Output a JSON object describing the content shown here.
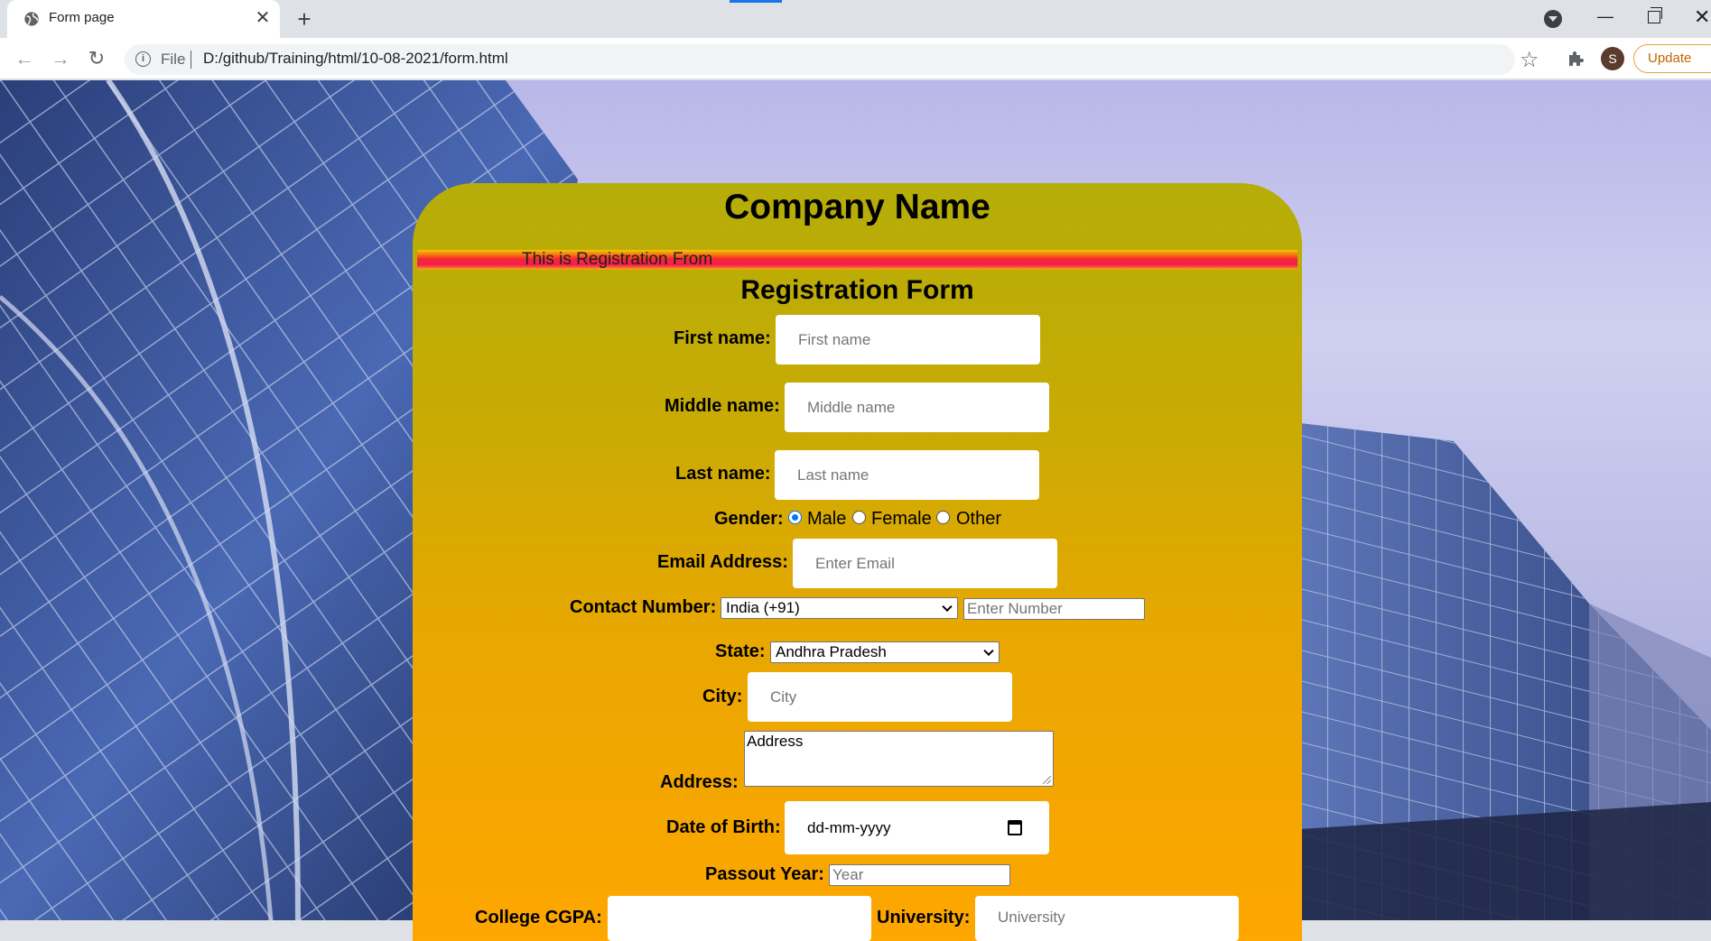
{
  "browser": {
    "tab_title": "Form page",
    "new_tab_symbol": "+",
    "close_symbol": "✕",
    "scheme": "File",
    "url": "D:/github/Training/html/10-08-2021/form.html",
    "profile_initial": "S",
    "update_label": "Update",
    "accent": "#1a73e8"
  },
  "page": {
    "company_name": "Company Name",
    "marquee": "This is Registration From",
    "form_title": "Registration Form",
    "panel_colors": [
      "#b5ad08",
      "#ffa600"
    ]
  },
  "form": {
    "first_name": {
      "label": "First name:",
      "placeholder": "First name"
    },
    "middle_name": {
      "label": "Middle name:",
      "placeholder": "Middle name"
    },
    "last_name": {
      "label": "Last name:",
      "placeholder": "Last name"
    },
    "gender": {
      "label": "Gender:",
      "options": [
        "Male",
        "Female",
        "Other"
      ],
      "selected": "Male"
    },
    "email": {
      "label": "Email Address:",
      "placeholder": "Enter Email"
    },
    "contact": {
      "label": "Contact Number:",
      "country": "India (+91)",
      "placeholder": "Enter Number"
    },
    "state": {
      "label": "State:",
      "value": "Andhra Pradesh"
    },
    "city": {
      "label": "City:",
      "placeholder": "City"
    },
    "address": {
      "label": "Address:",
      "value": "Address"
    },
    "dob": {
      "label": "Date of Birth:",
      "placeholder": "dd-mm-yyyy"
    },
    "passout": {
      "label": "Passout Year:",
      "placeholder": "Year"
    },
    "cgpa": {
      "label": "College CGPA:",
      "placeholder": ""
    },
    "university": {
      "label": "University:",
      "placeholder": "University"
    }
  }
}
